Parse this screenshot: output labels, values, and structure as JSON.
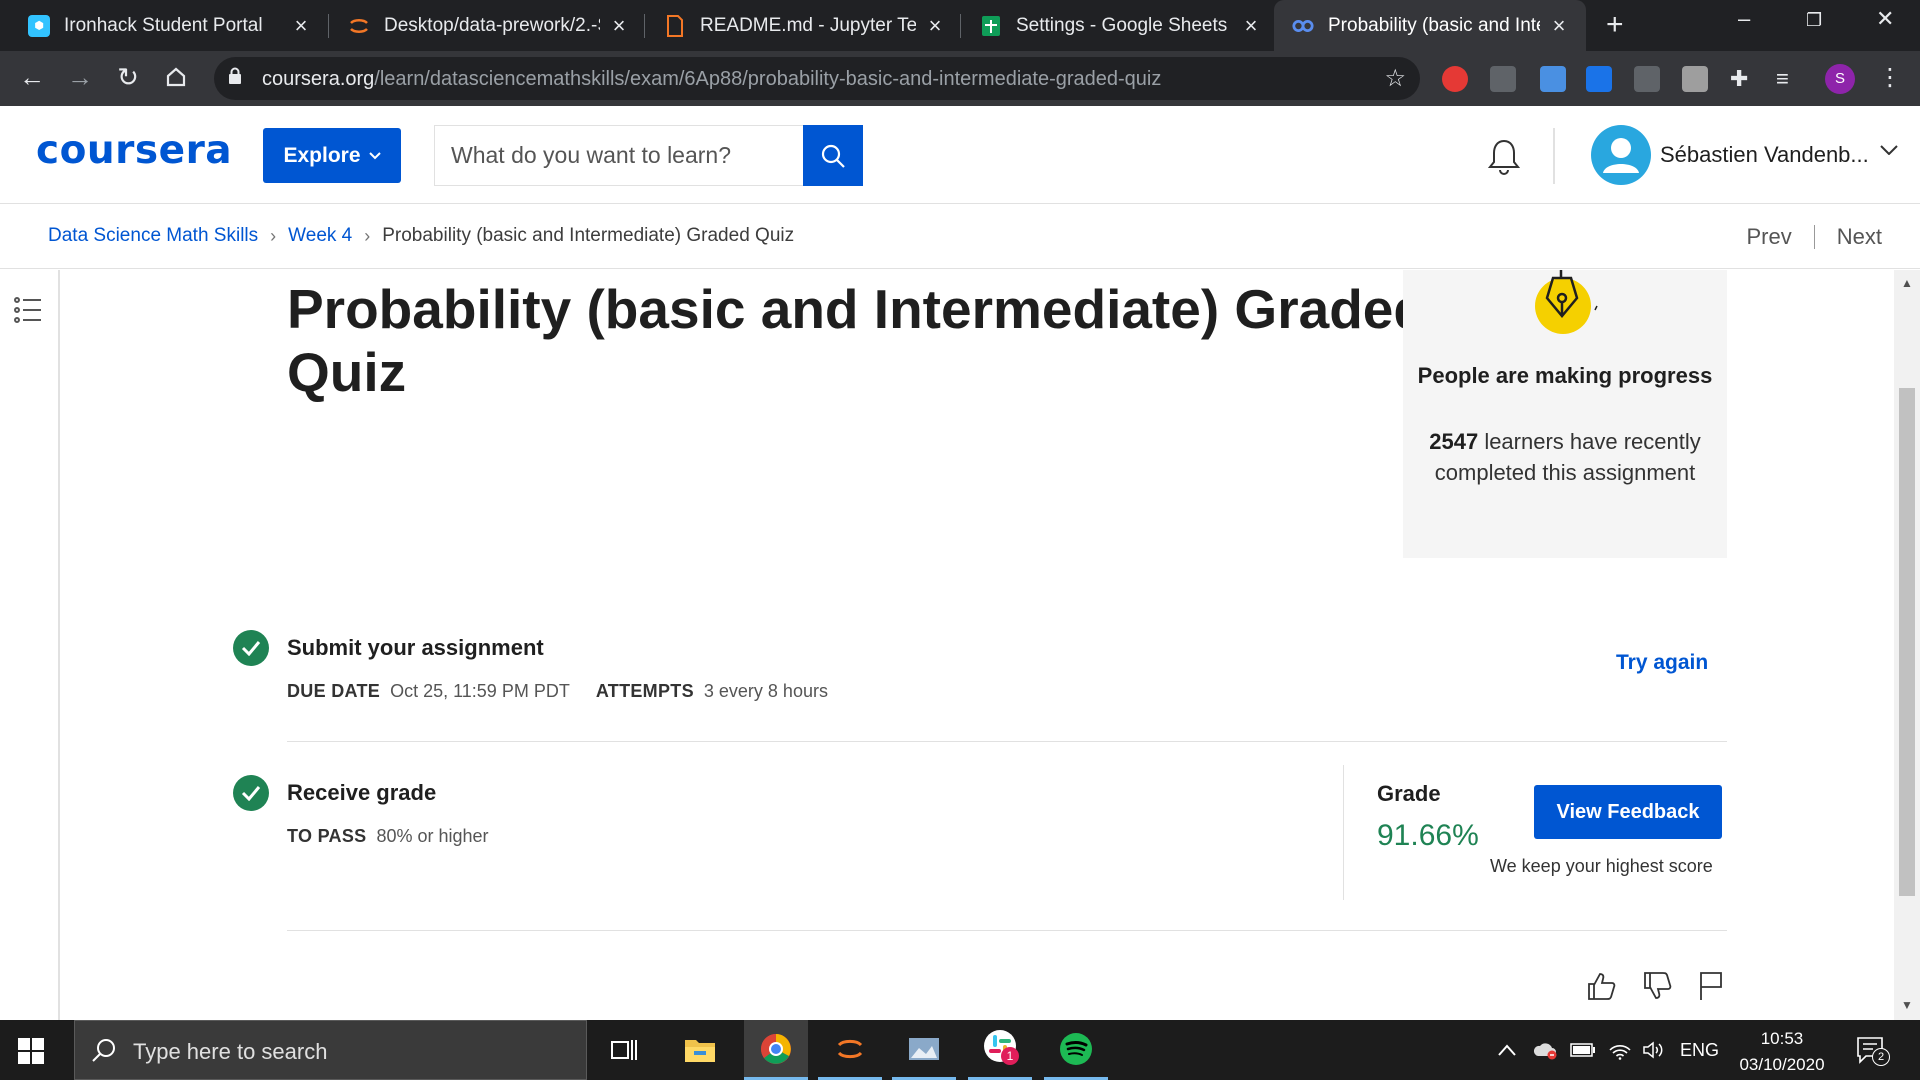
{
  "browser": {
    "tabs": [
      {
        "title": "Ironhack Student Portal",
        "favicon": "ironhack-icon",
        "color": "#32c3ff"
      },
      {
        "title": "Desktop/data-prework/2.-S",
        "favicon": "jupyter-icon",
        "color": "#f37726"
      },
      {
        "title": "README.md - Jupyter Text E",
        "favicon": "file-icon",
        "color": "#f37726"
      },
      {
        "title": "Settings - Google Sheets",
        "favicon": "sheets-icon",
        "color": "#0f9d58"
      },
      {
        "title": "Probability (basic and Intern",
        "favicon": "coursera-icon",
        "color": "#0056d2"
      }
    ],
    "url_host": "coursera.org",
    "url_path": "/learn/datasciencemathskills/exam/6Ap88/probability-basic-and-intermediate-graded-quiz",
    "profile_initial": "S"
  },
  "header": {
    "logo": "coursera",
    "explore_label": "Explore",
    "search_placeholder": "What do you want to learn?",
    "username": "Sébastien Vandenb..."
  },
  "breadcrumb": {
    "course": "Data Science Math Skills",
    "week": "Week 4",
    "current": "Probability (basic and Intermediate) Graded Quiz",
    "prev": "Prev",
    "next": "Next"
  },
  "main": {
    "title": "Probability (basic and Intermediate) Graded Quiz",
    "progress_card": {
      "heading": "People are making progress",
      "count": "2547",
      "text": "learners have recently completed this assignment"
    },
    "submit": {
      "title": "Submit your assignment",
      "due_label": "DUE DATE",
      "due_value": "Oct 25, 11:59 PM PDT",
      "attempts_label": "ATTEMPTS",
      "attempts_value": "3 every 8 hours",
      "try_again": "Try again"
    },
    "receive": {
      "title": "Receive grade",
      "pass_label": "TO PASS",
      "pass_value": "80% or higher",
      "grade_label": "Grade",
      "grade_value": "91.66%",
      "view_feedback": "View Feedback",
      "keep_score": "We keep your highest score"
    },
    "colors": {
      "accent": "#0056d2",
      "success": "#1f8354"
    }
  },
  "taskbar": {
    "search_placeholder": "Type here to search",
    "language": "ENG",
    "time": "10:53",
    "date": "03/10/2020",
    "slack_badge": "1",
    "notification_count": "2"
  }
}
